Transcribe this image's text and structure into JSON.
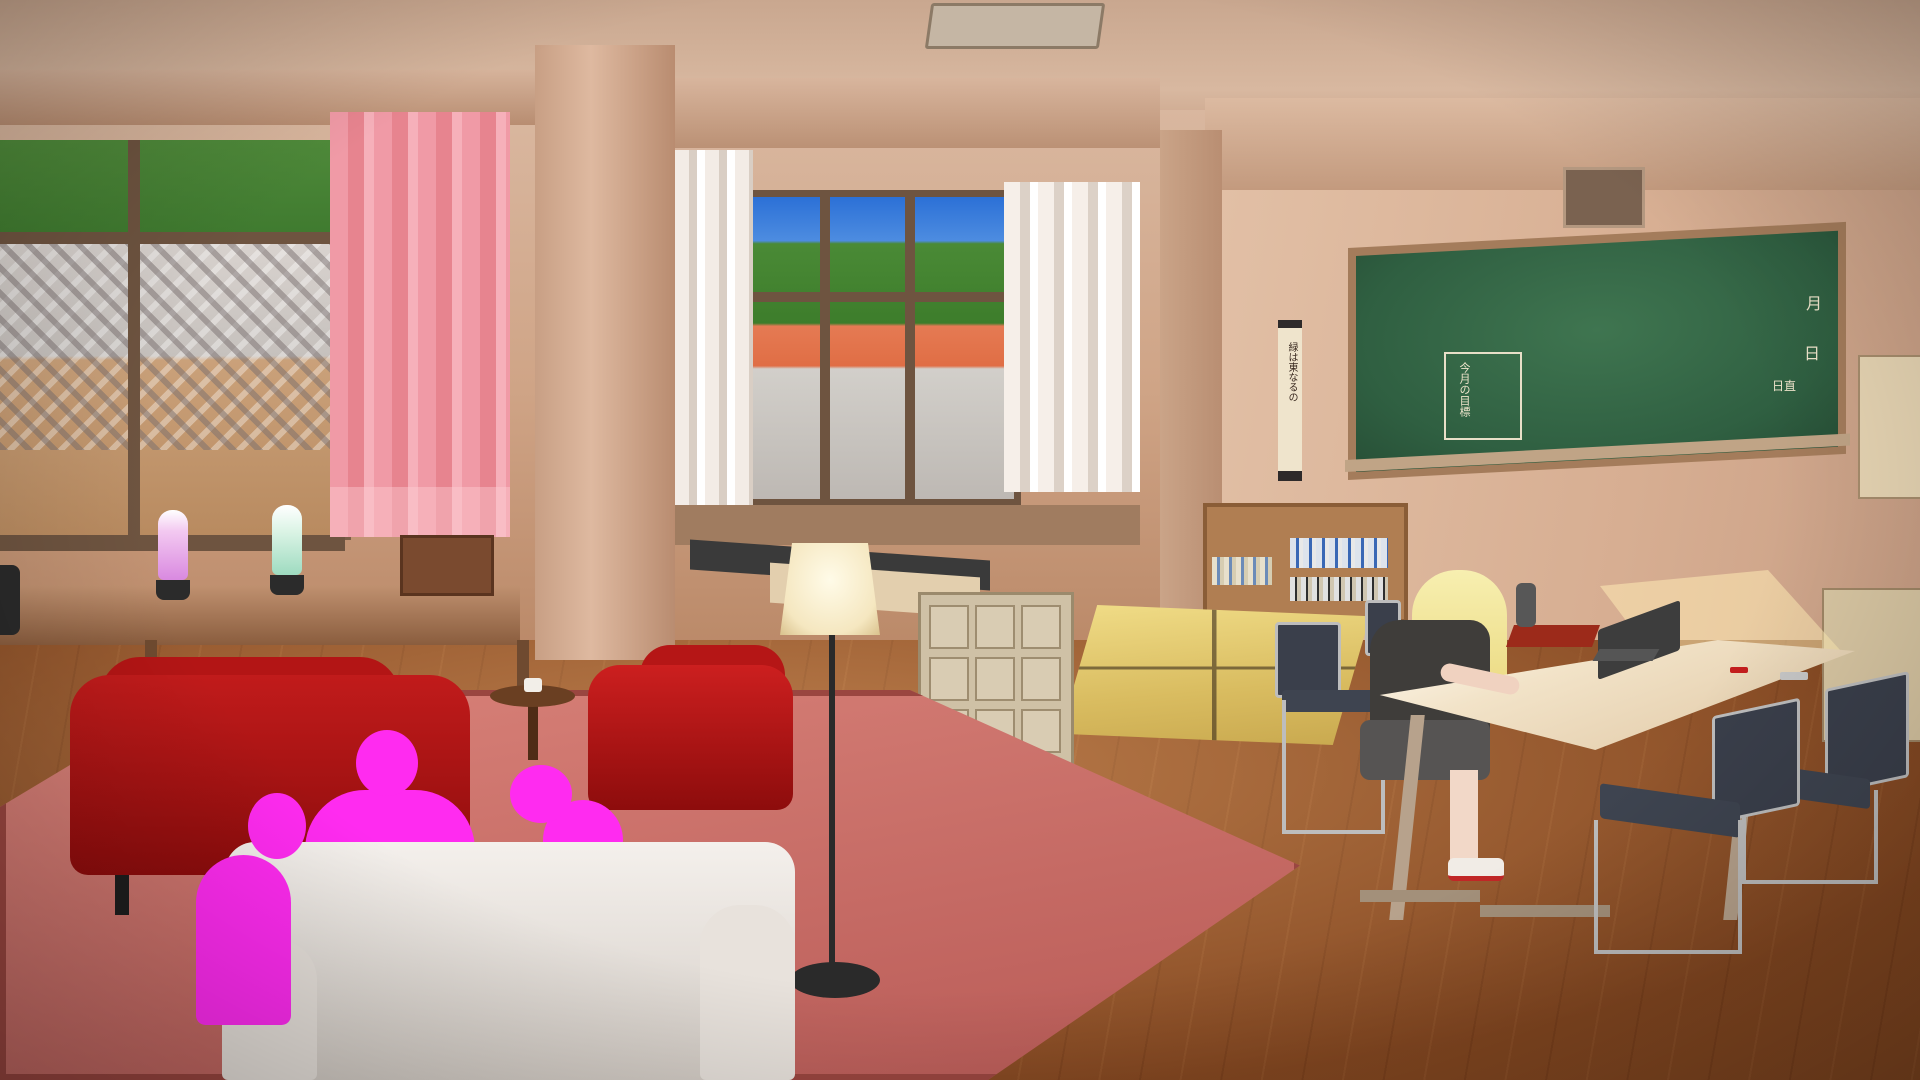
{
  "colors": {
    "rug": "#c56a64",
    "red_sofa": "#b31515",
    "silhouette": "#ff2bf0",
    "chalkboard": "#2f5f41",
    "floor": "#9a5326"
  },
  "chalkboard": {
    "month_label": "月",
    "day_label": "日",
    "duty_label": "日直",
    "title": "今月の目標"
  },
  "scroll": {
    "text": "緑は東なるの"
  }
}
